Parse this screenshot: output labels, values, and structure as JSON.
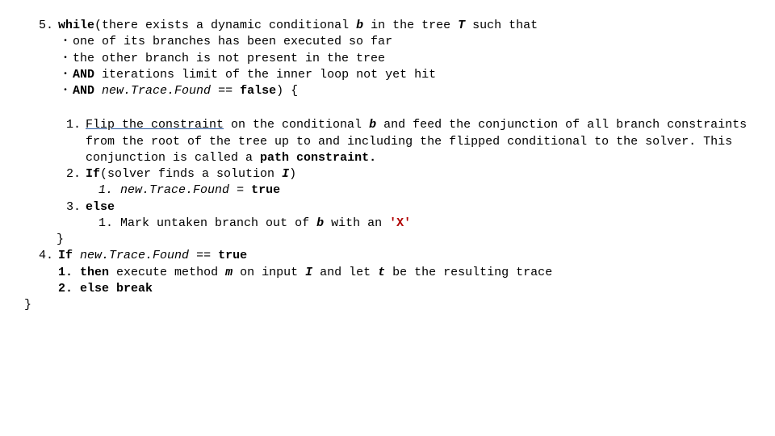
{
  "item5": {
    "num": "5.",
    "lead_a": "while",
    "lead_b": "(there exists a dynamic conditional ",
    "b": "b",
    "lead_c": " in the tree ",
    "T": "T",
    "lead_d": " such that",
    "bullets": [
      {
        "t": "one of its branches has been executed so far"
      },
      {
        "t": "the other branch is not present in the tree"
      },
      {
        "and": "AND",
        "t": " iterations limit of the inner loop not yet hit"
      },
      {
        "and": "AND",
        "nt": "new.Trace.Found",
        "eq": " == ",
        "f": "false",
        "close": ") {"
      }
    ]
  },
  "step1": {
    "num": "1.",
    "flip": "Flip the constraint",
    "a": " on the conditional ",
    "b": "b",
    "c": " and feed the conjunction of all branch constraints from the root of the tree up to and including the flipped conditional to the solver. This conjunction is called a ",
    "pc": "path constraint."
  },
  "step2": {
    "num": "2.",
    "if": "If",
    "a": "(solver finds a solution ",
    "I": "I",
    "b": ")",
    "sub_num": "1.",
    "nt": "new.Trace.Found",
    "eq": " = ",
    "true": "true"
  },
  "step3": {
    "num": "3.",
    "else": "else",
    "sub_num": "1.",
    "a": "Mark untaken branch out of ",
    "b": "b",
    "c": " with an ",
    "x": "'X'"
  },
  "close_inner": "}",
  "item4": {
    "num": "4.",
    "if": "If",
    "sp": " ",
    "nt": "new.Trace.Found",
    "eq": " == ",
    "true": "true",
    "sub1_num": "1.",
    "then": "then",
    "then_rest_a": "  execute method ",
    "m": "m",
    "then_rest_b": " on input ",
    "I": "I",
    "then_rest_c": " and let ",
    "t": "t",
    "then_rest_d": " be the resulting trace",
    "sub2_num": "2.",
    "else": "else",
    "break": " break"
  },
  "close_outer": "}"
}
